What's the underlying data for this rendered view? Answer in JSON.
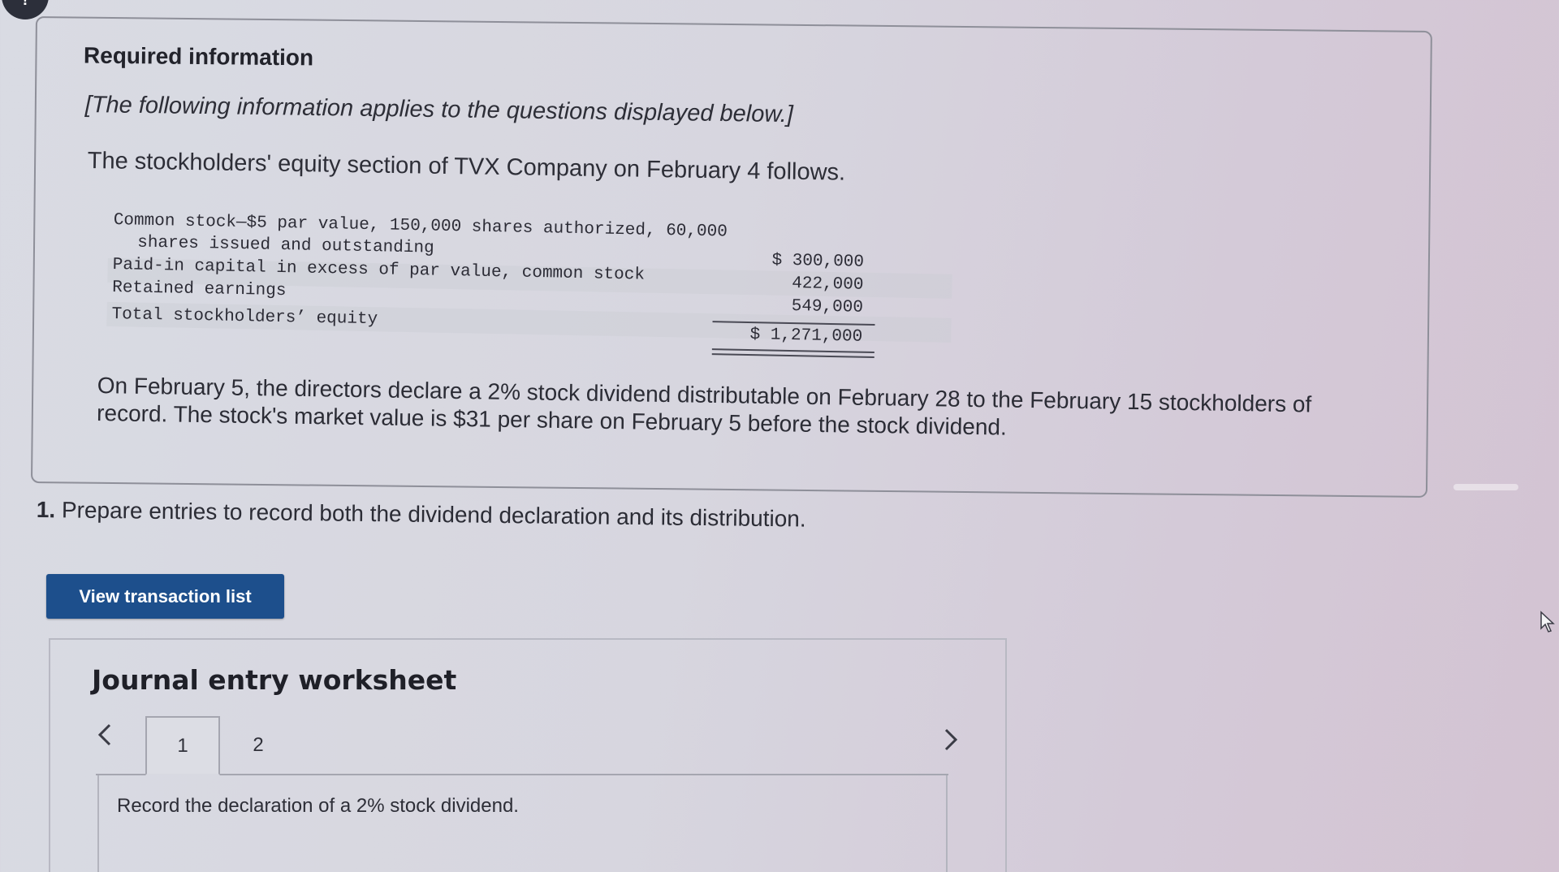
{
  "badge": {
    "label": "!"
  },
  "info": {
    "title": "Required information",
    "subtitle": "[The following information applies to the questions displayed below.]",
    "intro": "The stockholders' equity section of TVX Company on February 4 follows.",
    "equity_rows": [
      {
        "label_line1": "Common stock—$5 par value, 150,000 shares authorized, 60,000",
        "label_line2": "shares issued and outstanding",
        "amount": "$ 300,000"
      },
      {
        "label": "Paid-in capital in excess of par value, common stock",
        "amount": "422,000"
      },
      {
        "label": "Retained earnings",
        "amount": "549,000"
      },
      {
        "label": "Total stockholders’ equity",
        "amount": "$ 1,271,000"
      }
    ],
    "paragraph": "On February 5, the directors declare a 2% stock dividend distributable on February 28 to the February 15 stockholders of record. The stock's market value is $31 per share on February 5 before the stock dividend."
  },
  "question": {
    "number": "1.",
    "text": "Prepare entries to record both the dividend declaration and its distribution."
  },
  "view_transaction_button": {
    "label": "View transaction list"
  },
  "worksheet": {
    "title": "Journal entry worksheet",
    "prev_icon": "chevron-left-icon",
    "next_icon": "chevron-right-icon",
    "tabs": [
      {
        "label": "1",
        "active": true
      },
      {
        "label": "2",
        "active": false
      }
    ],
    "instruction": "Record the declaration of a 2% stock dividend."
  },
  "colors": {
    "button_bg": "#1d4f8c",
    "badge_bg": "#2c2f3a"
  }
}
